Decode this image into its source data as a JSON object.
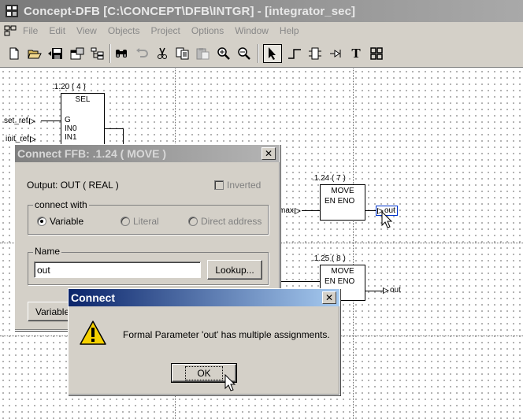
{
  "window": {
    "title": "Concept-DFB [C:\\CONCEPT\\DFB\\INTGR] - [integrator_sec]"
  },
  "menu": [
    "File",
    "Edit",
    "View",
    "Objects",
    "Project",
    "Options",
    "Window",
    "Help"
  ],
  "toolbar": {
    "icons": [
      "new-file-icon",
      "open-folder-icon",
      "save-icon",
      "properties-icon",
      "hierarchy-icon",
      "find-icon",
      "undo-icon",
      "cut-icon",
      "copy-icon",
      "paste-icon",
      "zoom-in-icon",
      "zoom-out-icon",
      "select-pointer-icon",
      "link-icon",
      "ffb-icon",
      "variable-icon",
      "text-icon",
      "grid-icon"
    ],
    "text_tool_glyph": "T"
  },
  "diagram": {
    "sel_block": {
      "tag": ".1.20 ( 4 )",
      "name": "SEL",
      "pins": [
        "G",
        "IN0",
        "IN1"
      ]
    },
    "inputs": [
      "set_ref",
      "init_ref"
    ],
    "move1": {
      "tag": ".1.24 ( 7 )",
      "name": "MOVE",
      "pins": "EN  ENO",
      "in_var": "max",
      "out_var": "out"
    },
    "move2": {
      "tag": ".1.25 ( 8 )",
      "name": "MOVE",
      "pins": "EN  ENO",
      "out_var": "out"
    }
  },
  "connect_ffb": {
    "title": "Connect FFB:  .1.24  ( MOVE )",
    "output_label": "Output:  OUT  ( REAL )",
    "inverted_label": "Inverted",
    "connect_with_label": "connect with",
    "radio_variable": "Variable",
    "radio_literal": "Literal",
    "radio_direct": "Direct address",
    "name_label": "Name",
    "name_value": "out",
    "lookup_button": "Lookup...",
    "variable_button": "Variable"
  },
  "connect_msg": {
    "title": "Connect",
    "message": "Formal Parameter  'out'  has multiple assignments.",
    "ok_button": "OK",
    "icon": "warning-icon"
  },
  "colors": {
    "active_title": "#0a246a",
    "face": "#d4d0c8",
    "warning_yellow": "#f5d000"
  }
}
